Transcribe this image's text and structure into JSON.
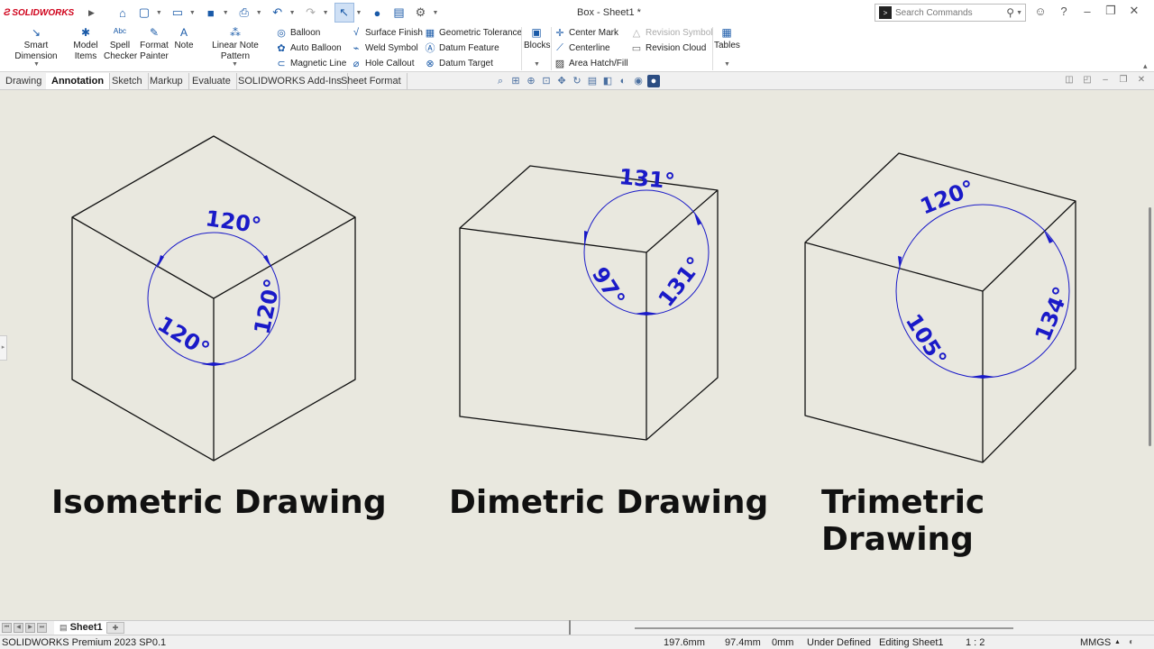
{
  "app": {
    "logo_text": "SOLIDWORKS",
    "doc_title": "Box - Sheet1 *"
  },
  "search": {
    "placeholder": "Search Commands"
  },
  "ribbon": {
    "smart_dimension": "Smart Dimension",
    "model_items_1": "Model",
    "model_items_2": "Items",
    "spell_checker_1": "Spell",
    "spell_checker_2": "Checker",
    "format_painter_1": "Format",
    "format_painter_2": "Painter",
    "note": "Note",
    "linear_note_pattern": "Linear Note Pattern",
    "balloon": "Balloon",
    "auto_balloon": "Auto Balloon",
    "magnetic_line": "Magnetic Line",
    "surface_finish": "Surface Finish",
    "weld_symbol": "Weld Symbol",
    "hole_callout": "Hole Callout",
    "geometric_tolerance": "Geometric Tolerance",
    "datum_feature": "Datum Feature",
    "datum_target": "Datum Target",
    "blocks": "Blocks",
    "center_mark": "Center Mark",
    "centerline": "Centerline",
    "area_hatch": "Area Hatch/Fill",
    "revision_symbol": "Revision Symbol",
    "revision_cloud": "Revision Cloud",
    "tables": "Tables"
  },
  "tabs": [
    "Drawing",
    "Annotation",
    "Sketch",
    "Markup",
    "Evaluate",
    "SOLIDWORKS Add-Ins",
    "Sheet Format"
  ],
  "active_tab": "Annotation",
  "drawings": {
    "iso": {
      "caption": "Isometric Drawing",
      "angle_top": "120°",
      "angle_left": "120°",
      "angle_right": "120°"
    },
    "di": {
      "caption": "Dimetric Drawing",
      "angle_top": "131°",
      "angle_left": "97°",
      "angle_right": "131°"
    },
    "tri": {
      "caption": "Trimetric Drawing",
      "angle_top": "120°",
      "angle_left": "105°",
      "angle_right": "134°"
    }
  },
  "sheet": {
    "tab_label": "Sheet1"
  },
  "status": {
    "product": "SOLIDWORKS Premium 2023 SP0.1",
    "x": "197.6mm",
    "y": "97.4mm",
    "z": "0mm",
    "state": "Under Defined",
    "editing": "Editing Sheet1",
    "scale": "1 : 2",
    "units": "MMGS"
  },
  "colors": {
    "dimension": "#1a1ac8",
    "canvas": "#e9e8df",
    "brand": "#d0021b"
  }
}
